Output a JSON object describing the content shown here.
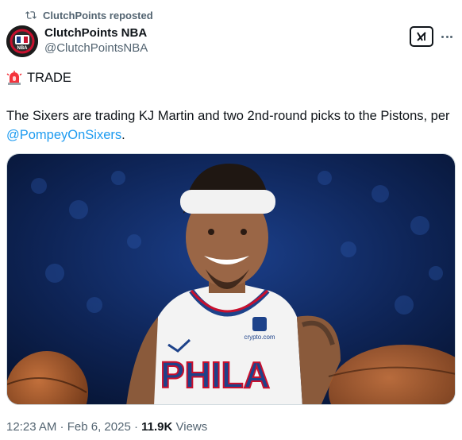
{
  "repost": {
    "text": "ClutchPoints reposted"
  },
  "author": {
    "name": "ClutchPoints NBA",
    "handle": "@ClutchPointsNBA",
    "avatar_label": "NBA"
  },
  "tweet": {
    "label": "TRADE",
    "text_before": "The Sixers are trading KJ Martin and two 2nd-round picks to the Pistons, per ",
    "mention": "@PompeyOnSixers",
    "text_after": "."
  },
  "media": {
    "jersey_text": "PHILA",
    "sponsor_text": "crypto.com"
  },
  "meta": {
    "time": "12:23 AM",
    "separator": " · ",
    "date": "Feb 6, 2025",
    "separator2": " · ",
    "views_count": "11.9K",
    "views_label": " Views"
  },
  "colors": {
    "link": "#1d9bf0",
    "muted": "#536471",
    "text": "#0f1419",
    "jersey_red": "#c8102e",
    "jersey_blue": "#1d428a"
  },
  "icons": [
    "repost-icon",
    "avatar-logo",
    "x-grok-icon",
    "more-icon",
    "siren-icon"
  ]
}
